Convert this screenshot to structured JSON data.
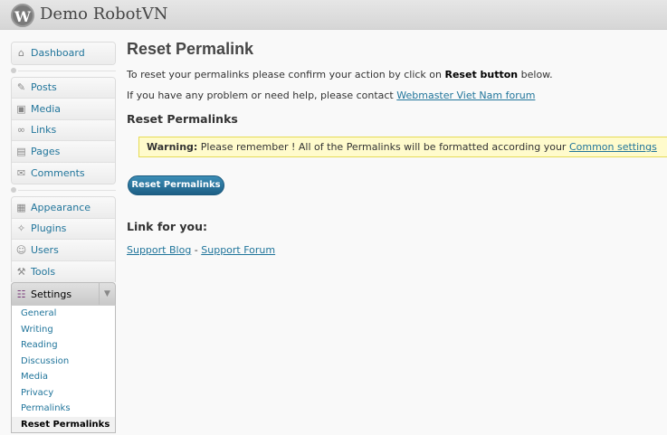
{
  "header": {
    "logo_letter": "W",
    "site_title": "Demo RobotVN"
  },
  "sidebar": {
    "group1": [
      {
        "icon": "⌂",
        "label": "Dashboard"
      }
    ],
    "group2": [
      {
        "icon": "✎",
        "label": "Posts"
      },
      {
        "icon": "▣",
        "label": "Media"
      },
      {
        "icon": "∞",
        "label": "Links"
      },
      {
        "icon": "▤",
        "label": "Pages"
      },
      {
        "icon": "✉",
        "label": "Comments"
      }
    ],
    "group3": [
      {
        "icon": "▦",
        "label": "Appearance"
      },
      {
        "icon": "✧",
        "label": "Plugins"
      },
      {
        "icon": "☺",
        "label": "Users"
      },
      {
        "icon": "⚒",
        "label": "Tools"
      }
    ],
    "settings": {
      "icon": "☷",
      "label": "Settings",
      "arrow": "▼",
      "items": [
        "General",
        "Writing",
        "Reading",
        "Discussion",
        "Media",
        "Privacy",
        "Permalinks",
        "Reset Permalinks"
      ],
      "current": "Reset Permalinks"
    }
  },
  "main": {
    "title": "Reset Permalink",
    "intro_before": "To reset your permalinks please confirm your action by click on ",
    "intro_bold": "Reset button",
    "intro_after": " below.",
    "help_before": "If you have any problem or need help, please contact ",
    "help_link": "Webmaster Viet Nam forum",
    "section_title": "Reset Permalinks",
    "warning_label": "Warning:",
    "warning_text": " Please remember ! All of the Permalinks will be formatted according your ",
    "warning_link": "Common settings",
    "button_label": "Reset Permalinks",
    "links_title": "Link for you:",
    "link1": "Support Blog",
    "link_sep": " - ",
    "link2": "Support Forum"
  }
}
